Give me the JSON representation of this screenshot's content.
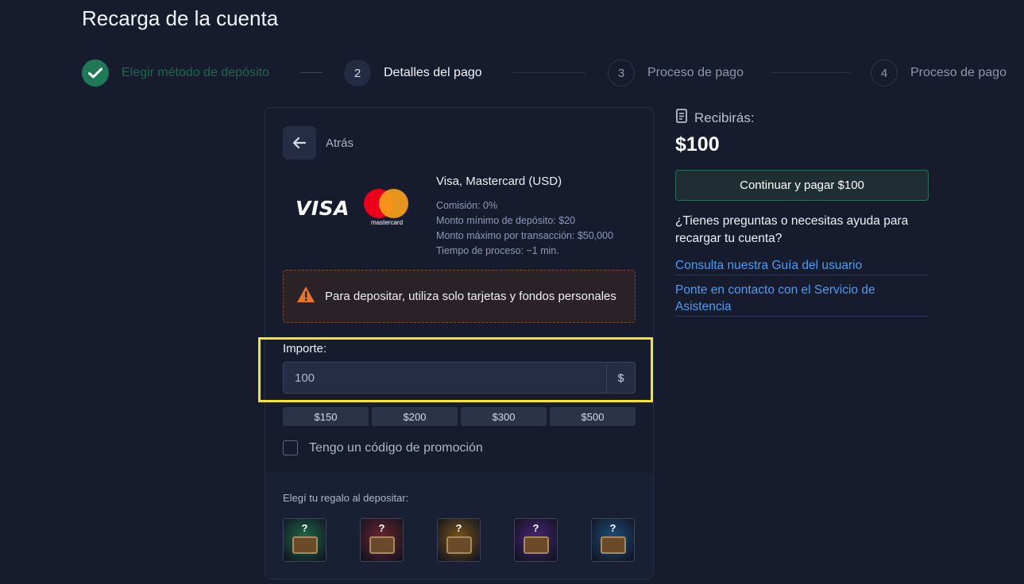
{
  "page": {
    "title": "Recarga de la cuenta"
  },
  "stepper": [
    {
      "number": "",
      "label": "Elegir método de depósito",
      "state": "done"
    },
    {
      "number": "2",
      "label": "Detalles del pago",
      "state": "active"
    },
    {
      "number": "3",
      "label": "Proceso de pago",
      "state": "pending"
    },
    {
      "number": "4",
      "label": "Proceso de pago",
      "state": "pending"
    }
  ],
  "card": {
    "back_label": "Atrás",
    "logos": {
      "visa": "VISA",
      "mastercard": "mastercard"
    },
    "method": {
      "name": "Visa, Mastercard (USD)",
      "info": [
        "Comisión: 0%",
        "Monto mínimo de depósito: $20",
        "Monto máximo por transacción: $50,000",
        "Tiempo de proceso: ~1 min."
      ]
    },
    "warning": "Para depositar, utiliza solo tarjetas y fondos personales",
    "amount": {
      "label": "Importe:",
      "value": "100",
      "currency": "$"
    },
    "quick_amounts": [
      "$150",
      "$200",
      "$300",
      "$500"
    ],
    "promo_label": "Tengo un código de promoción",
    "gift_label": "Elegí tu regalo al depositar:",
    "chests": [
      {
        "name": "green",
        "color": "#1f6b4a"
      },
      {
        "name": "red",
        "color": "#6e2430"
      },
      {
        "name": "gold",
        "color": "#7a5418"
      },
      {
        "name": "purple",
        "color": "#4a2474"
      },
      {
        "name": "blue",
        "color": "#1f4f7e"
      }
    ],
    "chest_mark": "?"
  },
  "summary": {
    "receive_label": "Recibirás:",
    "receive_amount": "$100",
    "pay_button": "Continuar y pagar $100",
    "help_question": "¿Tienes preguntas o necesitas ayuda para recargar tu cuenta?",
    "links": [
      "Consulta nuestra Guía del usuario",
      "Ponte en contacto con el Servicio de Asistencia"
    ]
  },
  "colors": {
    "background": "#161b2e",
    "accent_green": "#1e7a56",
    "link": "#4f9cf0",
    "warning_icon": "#e8742a",
    "highlight": "#f5e625"
  }
}
